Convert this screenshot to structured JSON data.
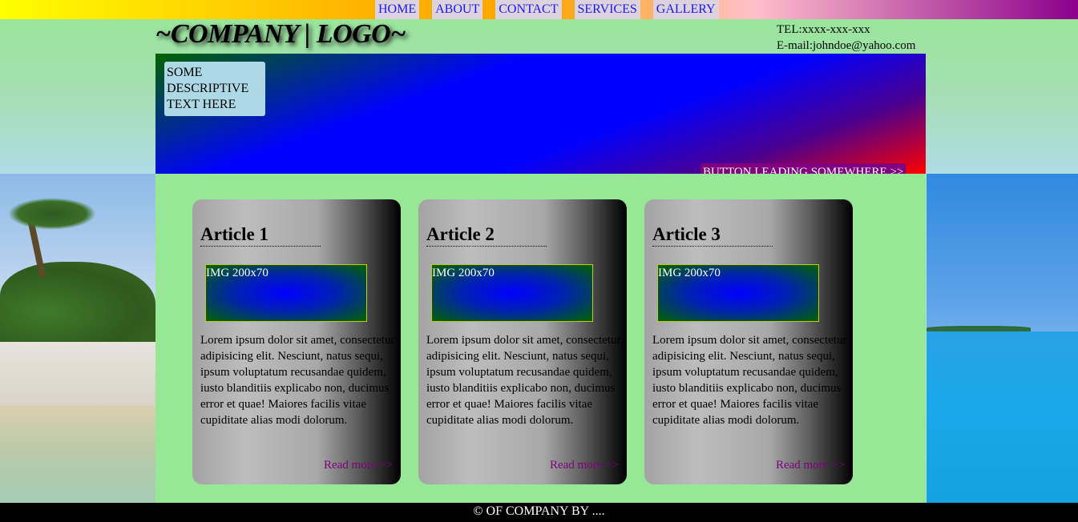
{
  "nav": {
    "items": [
      "HOME",
      "ABOUT",
      "CONTACT",
      "SERVICES",
      "GALLERY"
    ]
  },
  "header": {
    "logo": "~COMPANY | LOGO~",
    "tel": "TEL:xxxx-xxx-xxx",
    "email": "E-mail:johndoe@yahoo.com"
  },
  "hero": {
    "text": "SOME DESCRIPTIVE TEXT HERE",
    "button": "BUTTON LEADING SOMEWHERE >>"
  },
  "articles": [
    {
      "title": "Article 1",
      "img_label": "IMG 200x70",
      "body": "Lorem ipsum dolor sit amet, consectetur adipisicing elit. Nesciunt, natus sequi, ipsum voluptatum recusandae quidem, iusto blanditiis explicabo non, ducimus error et quae! Maiores facilis vitae cupiditate alias modi dolorum.",
      "more": "Read more >>"
    },
    {
      "title": "Article 2",
      "img_label": "IMG 200x70",
      "body": "Lorem ipsum dolor sit amet, consectetur adipisicing elit. Nesciunt, natus sequi, ipsum voluptatum recusandae quidem, iusto blanditiis explicabo non, ducimus error et quae! Maiores facilis vitae cupiditate alias modi dolorum.",
      "more": "Read more >>"
    },
    {
      "title": "Article 3",
      "img_label": "IMG 200x70",
      "body": "Lorem ipsum dolor sit amet, consectetur adipisicing elit. Nesciunt, natus sequi, ipsum voluptatum recusandae quidem, iusto blanditiis explicabo non, ducimus error et quae! Maiores facilis vitae cupiditate alias modi dolorum.",
      "more": "Read more >>"
    }
  ],
  "footer": {
    "text": "© OF COMPANY BY ...."
  },
  "colors": {
    "nav_link": "#1a1aee",
    "hero_button": "#800080",
    "read_more": "#800080",
    "page_bg": "#96e896",
    "footer_bg": "#000000"
  }
}
